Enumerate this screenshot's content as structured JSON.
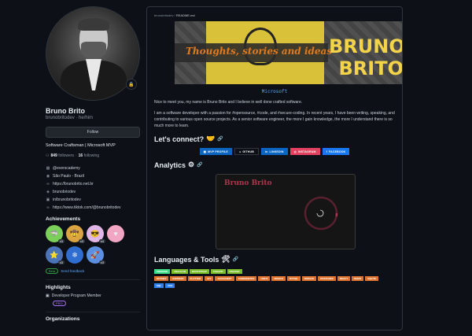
{
  "profile": {
    "name": "Bruno Brito",
    "login": "brunobritodev · he/him",
    "follow_label": "Follow",
    "bio": "Software Craftsman | Microsoft MVP",
    "followers_count": "849",
    "followers_label": "followers",
    "following_count": "16",
    "following_label": "following",
    "status_emoji": "🔒"
  },
  "vcard": [
    {
      "icon": "organization-icon",
      "glyph": "▦",
      "text": "@everscademy"
    },
    {
      "icon": "location-icon",
      "glyph": "◉",
      "text": "São Paulo - Brazil"
    },
    {
      "icon": "link-icon",
      "glyph": "∞",
      "text": "https://brunobrito.net.br"
    },
    {
      "icon": "mastodon-icon",
      "glyph": "◈",
      "text": "brunobriodev"
    },
    {
      "icon": "linkedin-icon",
      "glyph": "▣",
      "text": "in/brunobritodev"
    },
    {
      "icon": "link-icon",
      "glyph": "∞",
      "text": "https://www.tiktok.com/@brunobritodev"
    }
  ],
  "achievements": {
    "title": "Achievements",
    "items": [
      {
        "icon": "pull-shark-icon",
        "glyph": "🦈",
        "bg": "#7bd05a",
        "count": "x3"
      },
      {
        "icon": "quickdraw-icon",
        "glyph": "🤠",
        "bg": "#d9a441",
        "count": "x3"
      },
      {
        "icon": "yolo-icon",
        "glyph": "😎",
        "bg": "#e0b6e8",
        "count": "x4"
      },
      {
        "icon": "heart-icon",
        "glyph": "♥",
        "bg": "#f3a6c4",
        "count": ""
      },
      {
        "icon": "starstruck-icon",
        "glyph": "⭐",
        "bg": "#4b73b8",
        "count": "x3"
      },
      {
        "icon": "arctic-code-vault-icon",
        "glyph": "❄",
        "bg": "#2f6dd0",
        "count": ""
      },
      {
        "icon": "galaxy-brain-icon",
        "glyph": "🚀",
        "bg": "#5c8fe0",
        "count": "x3"
      }
    ],
    "beta_label": "Beta",
    "feedback_label": "Send feedback"
  },
  "highlights": {
    "title": "Highlights",
    "program": "Developer Program Member",
    "pro": "PRO"
  },
  "organizations": {
    "title": "Organizations"
  },
  "readme": {
    "path_user": "brunobritodev",
    "path_sep": "/",
    "path_file": "README",
    "path_ext": ".md",
    "banner_tagline": "Thoughts, stories and ideas",
    "banner_name": "BRUNO BRITO",
    "microsoft": "Microsoft",
    "intro": "Nice to meet you, my name is Bruno Brito and I believe in well done crafted software.",
    "about": "I am a software developer with a passion for #opensource, #code, and #secure-coding. In recent years, I have been writing, speaking, and contributing to various open source projects. As a senior software engineer, the more I gain knowledge, the more I understand there is so much more to learn."
  },
  "connect": {
    "title": "Let's connect?",
    "emoji": "🤝",
    "buttons": [
      {
        "icon": "mvp-icon",
        "glyph": "▦",
        "label": "MVP PROFILE",
        "color": "#0a66c2"
      },
      {
        "icon": "github-icon",
        "glyph": "●",
        "label": "GITHUB",
        "color": "#0d1117"
      },
      {
        "icon": "linkedin-icon",
        "glyph": "in",
        "label": "LINKEDIN",
        "color": "#0a66c2"
      },
      {
        "icon": "instagram-icon",
        "glyph": "◎",
        "label": "INSTAGRAM",
        "color": "#e4405f"
      },
      {
        "icon": "facebook-icon",
        "glyph": "f",
        "label": "FACEBOOK",
        "color": "#1877f2"
      }
    ]
  },
  "analytics": {
    "title": "Analytics",
    "emoji": "⚙",
    "card_title": "Bruno Brito",
    "ring_color": "#b0344d"
  },
  "languages": {
    "title": "Languages & Tools",
    "emoji": "🛠",
    "rows": [
      [
        {
          "label": "ANDROID",
          "color": "#3ddc84"
        },
        {
          "label": "ANGULAR",
          "color": "#7bbd2a"
        },
        {
          "label": "BOOTSTRAP",
          "color": "#7bbd2a"
        },
        {
          "label": "CSHARP",
          "color": "#7bbd2a"
        },
        {
          "label": "DOCKER",
          "color": "#7bbd2a"
        }
      ],
      [
        {
          "label": "DOTNET",
          "color": "#e0742e"
        },
        {
          "label": "EXPRESS",
          "color": "#e0742e"
        },
        {
          "label": "FLUTTER",
          "color": "#e0742e"
        },
        {
          "label": "GIT",
          "color": "#e0742e"
        },
        {
          "label": "JAVASCRIPT",
          "color": "#e0742e"
        },
        {
          "label": "KUBERNETES",
          "color": "#e0742e"
        },
        {
          "label": "LINUX",
          "color": "#e0742e"
        },
        {
          "label": "MONGO",
          "color": "#e0742e"
        },
        {
          "label": "MYSQL",
          "color": "#e0742e"
        },
        {
          "label": "NODEJS",
          "color": "#e0742e"
        },
        {
          "label": "POSTGRES",
          "color": "#e0742e"
        },
        {
          "label": "REACT",
          "color": "#e0742e"
        },
        {
          "label": "REDIS",
          "color": "#e0742e"
        },
        {
          "label": "SQLITE",
          "color": "#e0742e"
        }
      ],
      [
        {
          "label": "SQL",
          "color": "#2f80ed"
        },
        {
          "label": "VUE",
          "color": "#2f80ed"
        }
      ]
    ]
  }
}
